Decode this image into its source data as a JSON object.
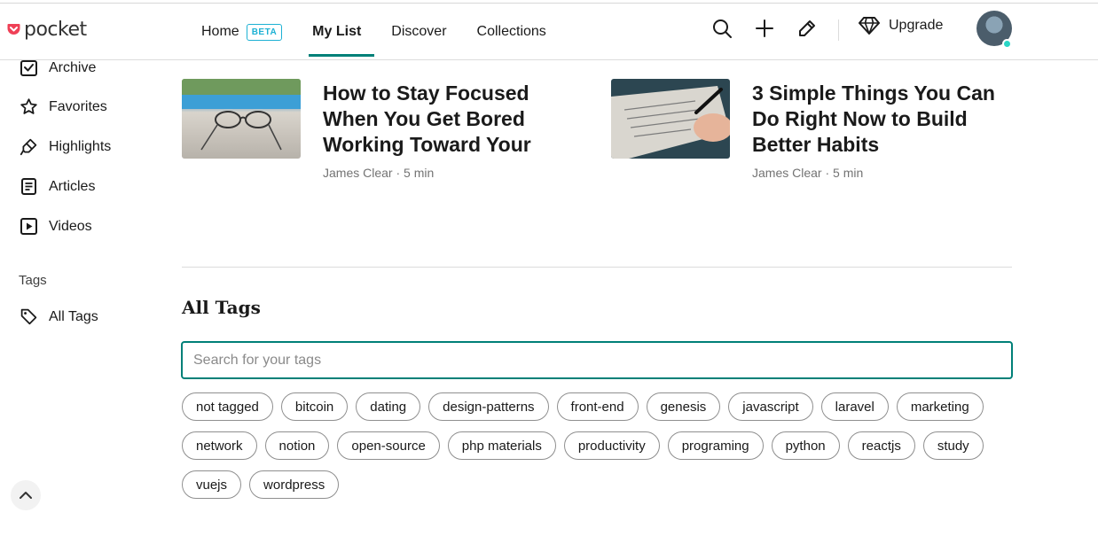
{
  "brand": {
    "name": "pocket",
    "color": "#ef4056"
  },
  "nav": {
    "items": [
      {
        "label": "Home",
        "badge": "BETA"
      },
      {
        "label": "My List",
        "active": true
      },
      {
        "label": "Discover"
      },
      {
        "label": "Collections"
      }
    ],
    "accent": "#008078"
  },
  "header_actions": {
    "icons": [
      "search-icon",
      "add-icon",
      "edit-icon"
    ],
    "upgrade_label": "Upgrade"
  },
  "sidebar": {
    "items": [
      {
        "label": "Archive",
        "icon": "archive-icon"
      },
      {
        "label": "Favorites",
        "icon": "star-icon"
      },
      {
        "label": "Highlights",
        "icon": "highlighter-icon"
      },
      {
        "label": "Articles",
        "icon": "article-icon"
      },
      {
        "label": "Videos",
        "icon": "video-icon"
      }
    ],
    "tags_heading": "Tags",
    "all_tags_label": "All Tags"
  },
  "articles": [
    {
      "title": "How to Stay Focused When You Get Bored Working Toward Your",
      "meta": "James Clear · 5 min"
    },
    {
      "title": "3 Simple Things You Can Do Right Now to Build Better Habits",
      "meta": "James Clear · 5 min"
    }
  ],
  "all_tags": {
    "title": "All Tags",
    "search_placeholder": "Search for your tags",
    "tags": [
      "not tagged",
      "bitcoin",
      "dating",
      "design-patterns",
      "front-end",
      "genesis",
      "javascript",
      "laravel",
      "marketing",
      "network",
      "notion",
      "open-source",
      "php materials",
      "productivity",
      "programing",
      "python",
      "reactjs",
      "study",
      "vuejs",
      "wordpress"
    ]
  }
}
